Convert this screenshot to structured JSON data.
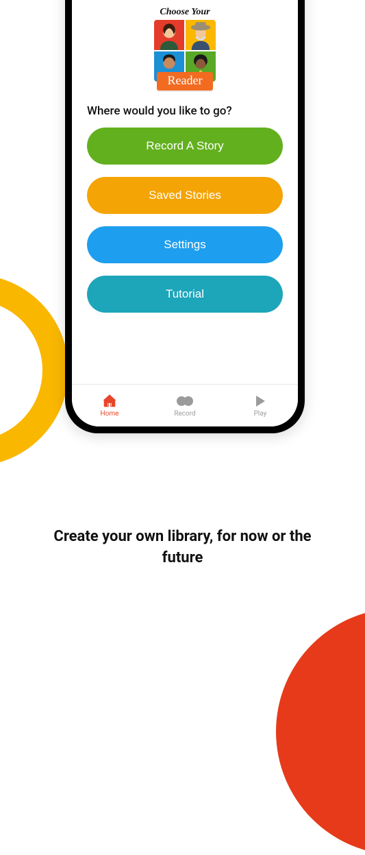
{
  "logo": {
    "top_text": "Choose Your",
    "ribbon_text": "Reader"
  },
  "prompt": "Where would you like to go?",
  "buttons": {
    "record_story": "Record A Story",
    "saved_stories": "Saved Stories",
    "settings": "Settings",
    "tutorial": "Tutorial"
  },
  "tabs": {
    "home": "Home",
    "record": "Record",
    "play": "Play"
  },
  "tagline": "Create your own library, for now or the future",
  "colors": {
    "green": "#62b01e",
    "orange": "#f5a406",
    "blue": "#1e9eee",
    "teal": "#1da5ba",
    "accent": "#e8452a"
  }
}
